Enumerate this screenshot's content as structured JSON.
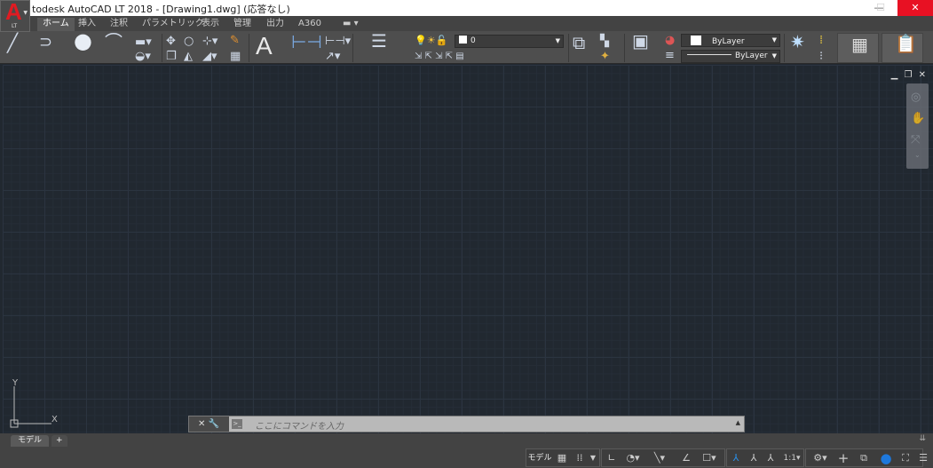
{
  "window": {
    "title": "todesk AutoCAD LT 2018 - [Drawing1.dwg] (応答なし)",
    "app_letter": "A",
    "app_badge": "LT",
    "minimize": "—",
    "maximize": "☐",
    "close": "✕"
  },
  "tabs": [
    {
      "label": "ホーム"
    },
    {
      "label": "挿入"
    },
    {
      "label": "注釈"
    },
    {
      "label": "パラメトリック"
    },
    {
      "label": "表示"
    },
    {
      "label": "管理"
    },
    {
      "label": "出力"
    },
    {
      "label": "A360"
    }
  ],
  "ribbon": {
    "layer_value": "0",
    "color_value": "ByLayer",
    "linetype_value": "ByLayer"
  },
  "viewport": {
    "ucs_y": "Y",
    "ucs_x": "X"
  },
  "command": {
    "placeholder": "ここにコマンドを入力",
    "close": "✕"
  },
  "layout_tabs": [
    {
      "label": "モデル"
    },
    {
      "label": "+"
    }
  ],
  "status": {
    "model": "モデル",
    "scale": "1:1"
  },
  "colors": {
    "close_red": "#e81123",
    "autocad_red": "#e01b22",
    "canvas": "#212830",
    "active_blue": "#1e78dc"
  }
}
